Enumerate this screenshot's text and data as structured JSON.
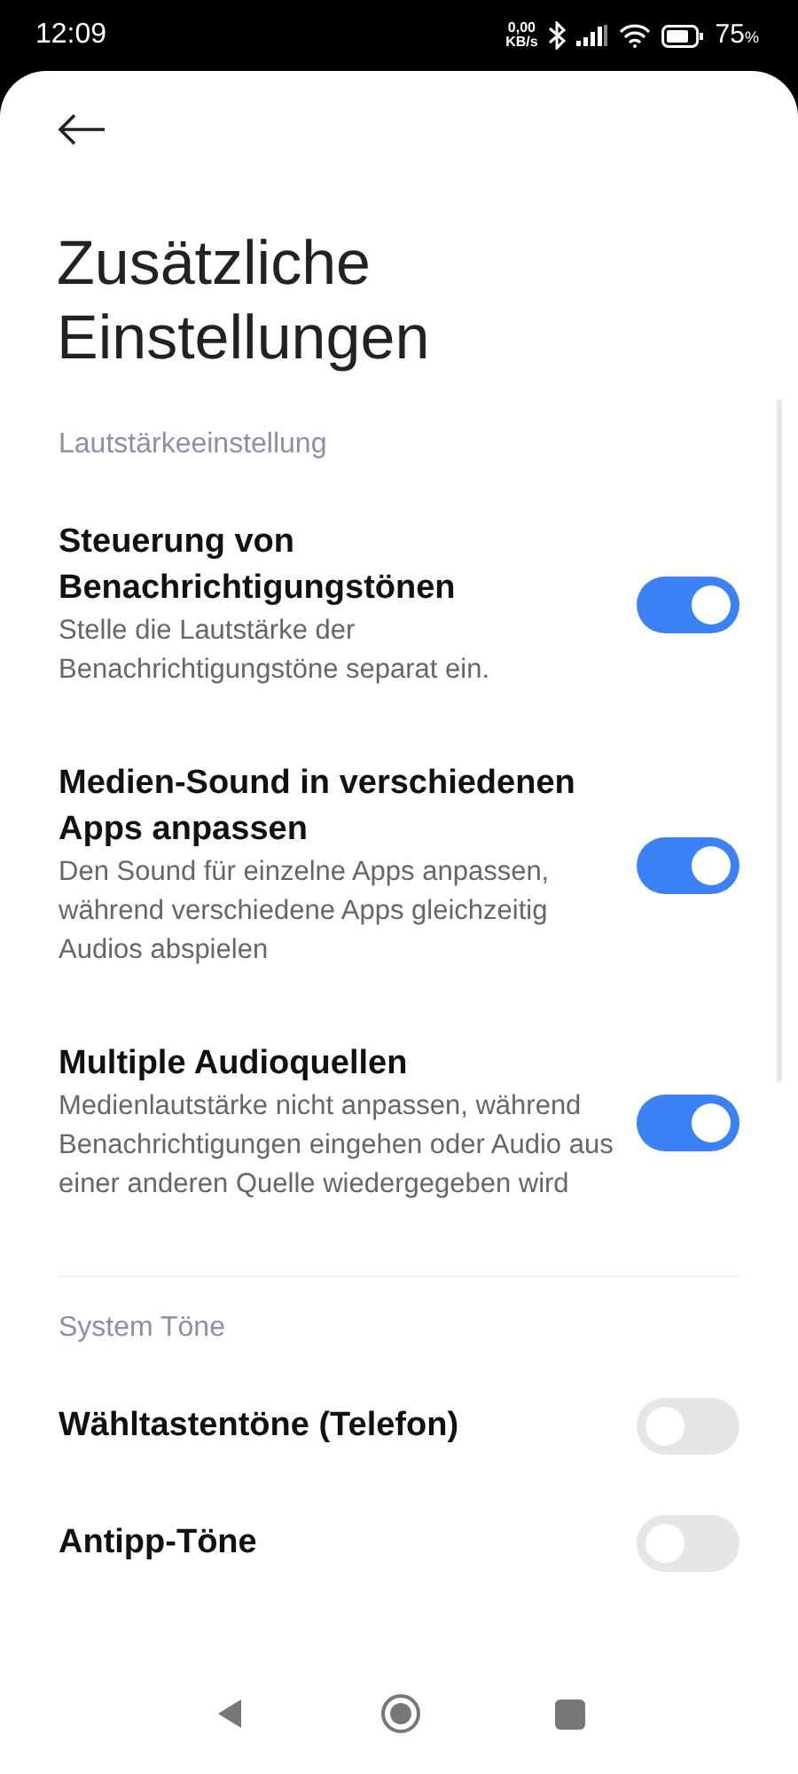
{
  "status_bar": {
    "time": "12:09",
    "net_speed_value": "0,00",
    "net_speed_unit": "KB/s",
    "battery_percent": "75",
    "battery_unit": "%"
  },
  "page": {
    "title": "Zusätzliche Einstellungen"
  },
  "sections": [
    {
      "title": "Lautstärkeeinstellung",
      "items": [
        {
          "title": "Steuerung von Benachrichtigungstönen",
          "description": "Stelle die Lautstärke der Benachrichtigungstöne separat ein.",
          "on": true
        },
        {
          "title": "Medien-Sound in verschiedenen Apps anpassen",
          "description": "Den Sound für einzelne Apps anpassen, während verschiedene Apps gleichzeitig Audios abspielen",
          "on": true
        },
        {
          "title": "Multiple Audioquellen",
          "description": "Medienlautstärke nicht anpassen, während Benachrichtigungen eingehen oder Audio aus einer anderen Quelle wiedergegeben wird",
          "on": true
        }
      ]
    },
    {
      "title": "System Töne",
      "items": [
        {
          "title": "Wähltastentöne (Telefon)",
          "on": false
        },
        {
          "title": "Antipp-Töne",
          "on": false
        }
      ]
    }
  ]
}
